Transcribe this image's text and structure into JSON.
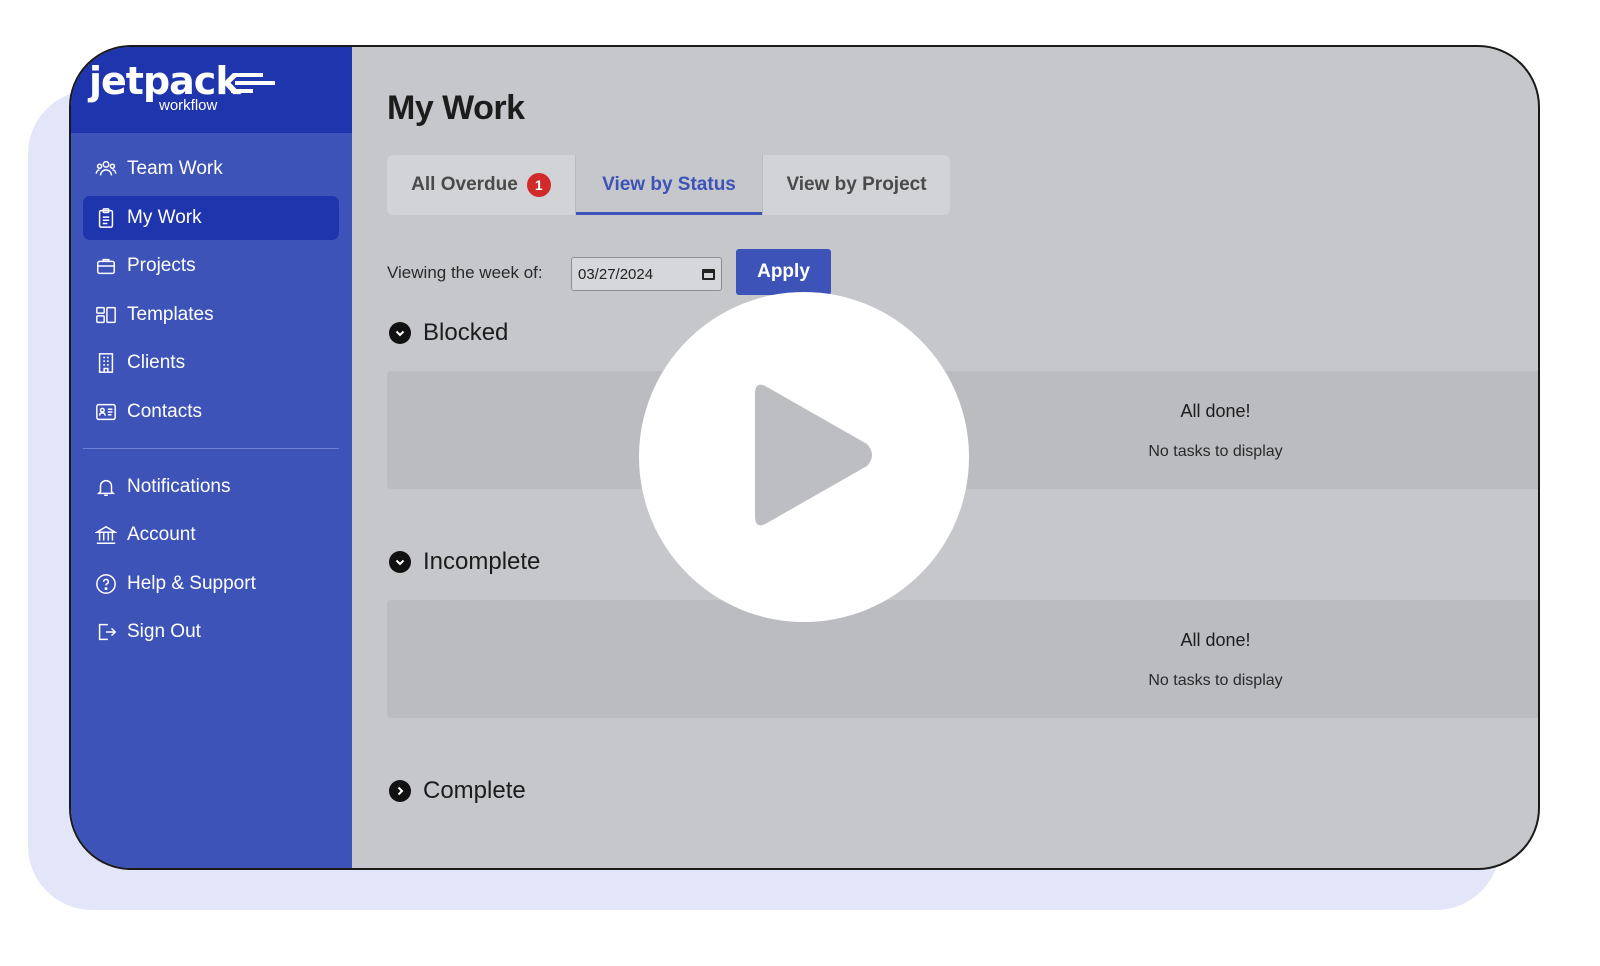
{
  "brand": {
    "logo_text": "jetpack",
    "logo_sub": "workflow"
  },
  "sidebar": {
    "items": [
      {
        "label": "Team Work",
        "icon": "team-icon"
      },
      {
        "label": "My Work",
        "icon": "clipboard-icon",
        "active": true
      },
      {
        "label": "Projects",
        "icon": "briefcase-icon"
      },
      {
        "label": "Templates",
        "icon": "templates-icon"
      },
      {
        "label": "Clients",
        "icon": "building-icon"
      },
      {
        "label": "Contacts",
        "icon": "contact-card-icon"
      }
    ],
    "secondary": [
      {
        "label": "Notifications",
        "icon": "bell-icon"
      },
      {
        "label": "Account",
        "icon": "bank-icon"
      },
      {
        "label": "Help & Support",
        "icon": "help-icon"
      },
      {
        "label": "Sign Out",
        "icon": "sign-out-icon"
      }
    ]
  },
  "main": {
    "title": "My Work",
    "tabs": [
      {
        "label": "All Overdue",
        "badge": "1"
      },
      {
        "label": "View by Status",
        "active": true
      },
      {
        "label": "View by Project"
      }
    ],
    "week_label": "Viewing the week of:",
    "week_value": "03/27/2024",
    "apply_label": "Apply",
    "sections": [
      {
        "title": "Blocked",
        "expanded": true,
        "empty_title": "All done!",
        "empty_sub": "No tasks to display"
      },
      {
        "title": "Incomplete",
        "expanded": true,
        "empty_title": "All done!",
        "empty_sub": "No tasks to display"
      },
      {
        "title": "Complete",
        "expanded": false
      }
    ]
  },
  "overlay": {
    "icon": "play-icon"
  },
  "colors": {
    "brand_dark": "#1f35ad",
    "brand": "#3d53b8",
    "badge": "#d02a2a"
  }
}
